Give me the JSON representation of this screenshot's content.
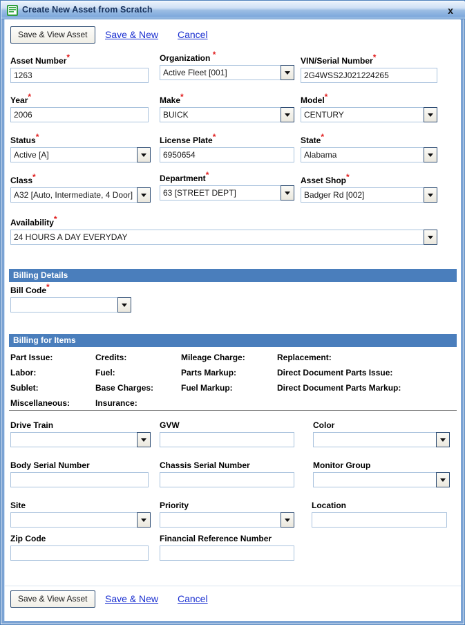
{
  "window": {
    "title": "Create New Asset from Scratch",
    "icon": "document-list-icon",
    "close_label": "x"
  },
  "toolbar": {
    "save_view_label": "Save & View Asset",
    "save_new_label": "Save & New",
    "cancel_label": "Cancel"
  },
  "fields": {
    "asset_number": {
      "label": "Asset Number",
      "required": "*",
      "value": "1263"
    },
    "organization": {
      "label": "Organization",
      "required": "*",
      "value": "Active Fleet [001]"
    },
    "vin": {
      "label": "VIN/Serial Number",
      "required": "*",
      "value": "2G4WSS2J021224265"
    },
    "year": {
      "label": "Year",
      "required": "*",
      "value": "2006"
    },
    "make": {
      "label": "Make",
      "required": "*",
      "value": "BUICK"
    },
    "model": {
      "label": "Model",
      "required": "*",
      "value": "CENTURY"
    },
    "status": {
      "label": "Status",
      "required": "*",
      "value": "Active [A]"
    },
    "license_plate": {
      "label": "License Plate",
      "required": "*",
      "value": "6950654"
    },
    "state": {
      "label": "State",
      "required": "*",
      "value": "Alabama"
    },
    "class": {
      "label": "Class",
      "required": "*",
      "value": "A32 [Auto, Intermediate, 4 Door]"
    },
    "department": {
      "label": "Department",
      "required": "*",
      "value": "63 [STREET DEPT]"
    },
    "asset_shop": {
      "label": "Asset Shop",
      "required": "*",
      "value": "Badger Rd [002]"
    },
    "availability": {
      "label": "Availability",
      "required": "*",
      "value": "24 HOURS A DAY EVERYDAY"
    },
    "bill_code": {
      "label": "Bill Code",
      "required": "*",
      "value": ""
    },
    "drive_train": {
      "label": "Drive Train",
      "required": "",
      "value": ""
    },
    "gvw": {
      "label": "GVW",
      "required": "",
      "value": ""
    },
    "color": {
      "label": "Color",
      "required": "",
      "value": ""
    },
    "body_serial": {
      "label": "Body Serial Number",
      "required": "",
      "value": ""
    },
    "chassis_serial": {
      "label": "Chassis Serial Number",
      "required": "",
      "value": ""
    },
    "monitor_group": {
      "label": "Monitor Group",
      "required": "",
      "value": ""
    },
    "site": {
      "label": "Site",
      "required": "",
      "value": ""
    },
    "priority": {
      "label": "Priority",
      "required": "",
      "value": ""
    },
    "location": {
      "label": "Location",
      "required": "",
      "value": ""
    },
    "zip_code": {
      "label": "Zip Code",
      "required": "",
      "value": ""
    },
    "financial_ref": {
      "label": "Financial Reference Number",
      "required": "",
      "value": ""
    }
  },
  "sections": {
    "billing_details": "Billing Details",
    "billing_for_items": "Billing for Items"
  },
  "billing_for_items": {
    "col1": [
      "Part Issue:",
      "Labor:",
      "Sublet:",
      "Miscellaneous:"
    ],
    "col2": [
      "Credits:",
      "Fuel:",
      "Base Charges:",
      "Insurance:"
    ],
    "col3": [
      "Mileage Charge:",
      "Parts Markup:",
      "Fuel Markup:",
      ""
    ],
    "col4": [
      "Replacement:",
      "Direct Document Parts Issue:",
      "Direct Document Parts Markup:",
      ""
    ]
  },
  "colors": {
    "section_header": "#4a7ebc",
    "required_marker": "#e01b1b",
    "link": "#1a2fd0",
    "window_frame": "#7ba3d4",
    "input_border": "#a9c2dd"
  }
}
